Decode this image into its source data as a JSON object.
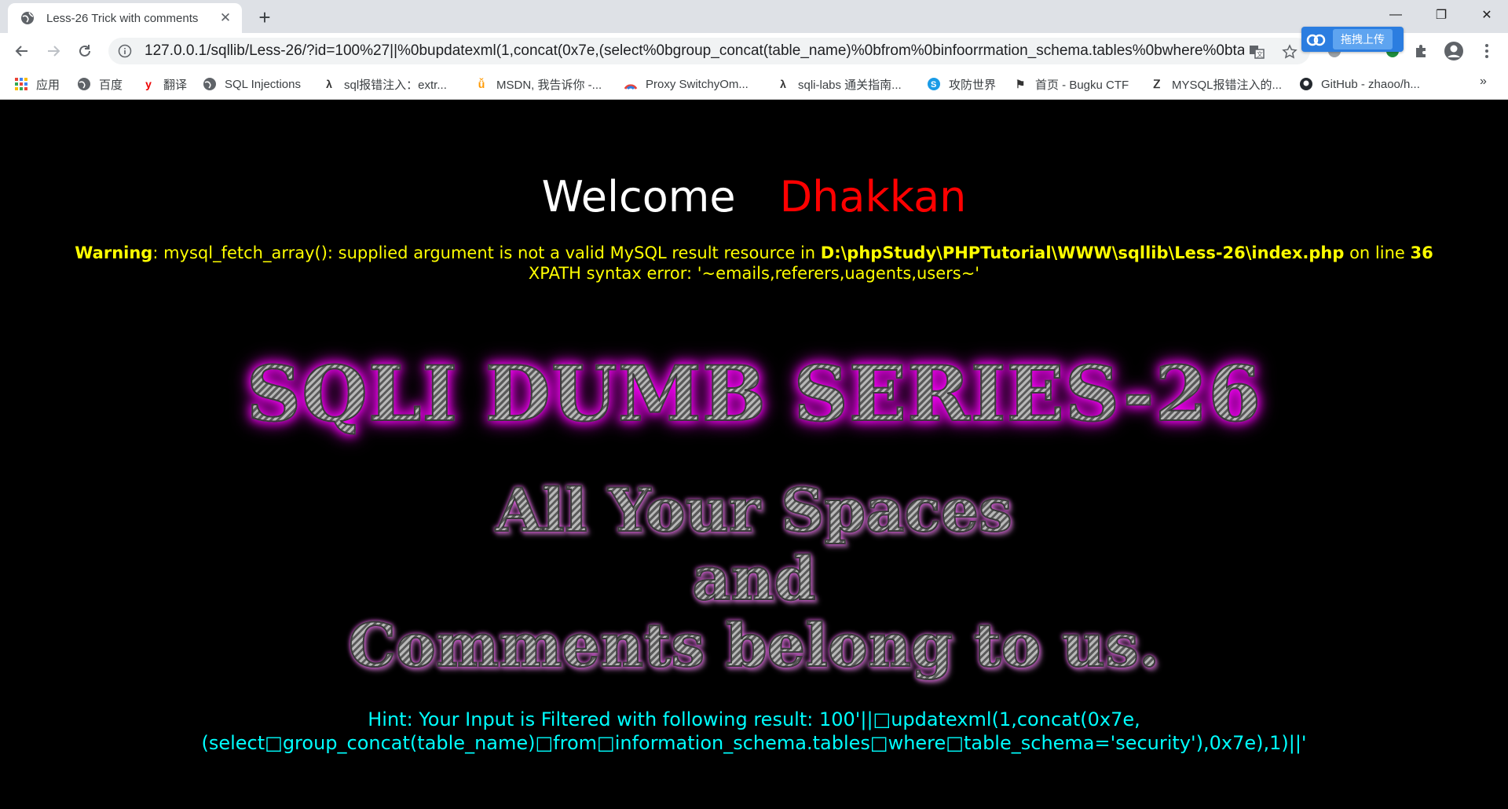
{
  "browser": {
    "tab_title": "Less-26 Trick with comments",
    "url": "127.0.0.1/sqllib/Less-26/?id=100%27||%0bupdatexml(1,concat(0x7e,(select%0bgroup_concat(table_name)%0bfrom%0binfoorrmation_schema.tables%0bwhere%0bta...",
    "extension_popup_label": "拖拽上传"
  },
  "bookmarks": [
    {
      "label": "应用",
      "icon": "apps-grid-icon"
    },
    {
      "label": "百度",
      "icon": "globe-icon"
    },
    {
      "label": "翻译",
      "icon": "youdao-icon"
    },
    {
      "label": "SQL Injections",
      "icon": "globe-icon"
    },
    {
      "label": "sql报错注入：extr...",
      "icon": "lambda-icon"
    },
    {
      "label": "MSDN, 我告诉你 -...",
      "icon": "msdn-icon"
    },
    {
      "label": "Proxy SwitchyOm...",
      "icon": "switchyomega-icon"
    },
    {
      "label": "sqli-labs 通关指南...",
      "icon": "lambda-icon"
    },
    {
      "label": "攻防世界",
      "icon": "adworld-icon"
    },
    {
      "label": "首页 - Bugku CTF",
      "icon": "flag-icon"
    },
    {
      "label": "MYSQL报错注入的...",
      "icon": "zhihu-icon"
    },
    {
      "label": "GitHub - zhaoo/h...",
      "icon": "github-icon"
    }
  ],
  "page": {
    "welcome": "Welcome",
    "name": "Dhakkan",
    "warning_label": "Warning",
    "warning_text": ": mysql_fetch_array(): supplied argument is not a valid MySQL result resource in ",
    "warning_path": "D:\\phpStudy\\PHPTutorial\\WWW\\sqllib\\Less-26\\index.php",
    "warning_online": " on line ",
    "warning_line": "36",
    "xpath_error": "XPATH syntax error: '~emails,referers,uagents,users~'",
    "series_title": "SQLI DUMB SERIES-26",
    "slogan_line1": "All Your Spaces",
    "slogan_line2": "and",
    "slogan_line3": "Comments belong to us.",
    "hint_line1": "Hint: Your Input is Filtered with following result: 100'||□updatexml(1,concat(0x7e,",
    "hint_line2": "(select□group_concat(table_name)□from□information_schema.tables□where□table_schema='security'),0x7e),1)||'"
  },
  "colors": {
    "welcome": "#ffffff",
    "name": "#ff0000",
    "warning": "#ffff00",
    "hint": "#00ffff",
    "background": "#000000"
  }
}
